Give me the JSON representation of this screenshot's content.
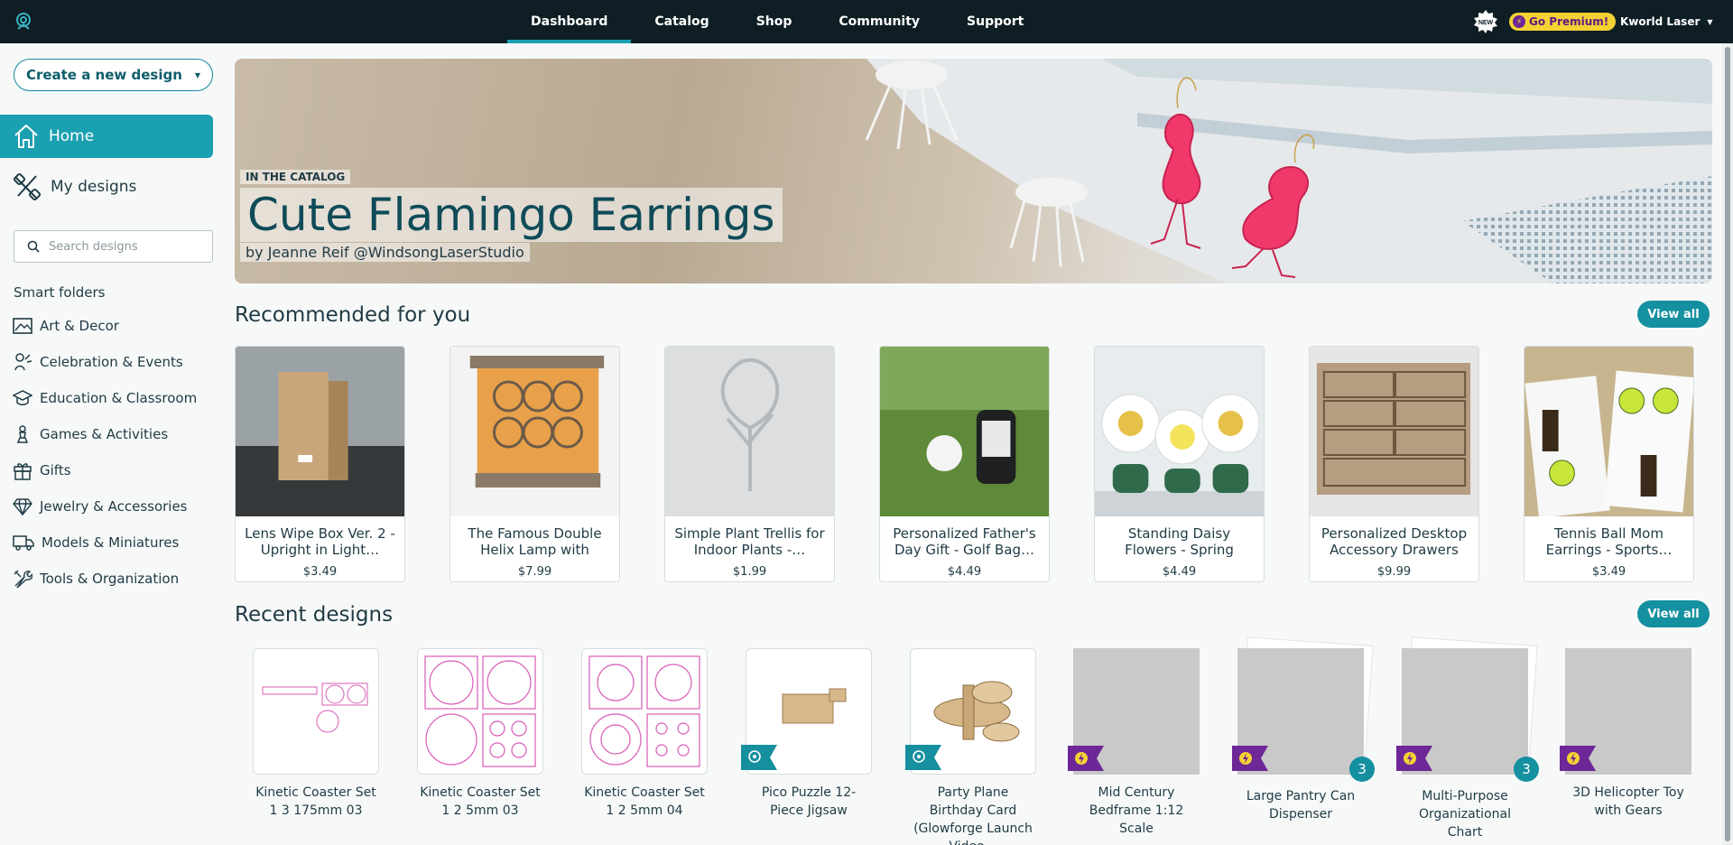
{
  "topbar": {
    "nav": [
      {
        "label": "Dashboard",
        "active": true
      },
      {
        "label": "Catalog",
        "active": false
      },
      {
        "label": "Shop",
        "active": false
      },
      {
        "label": "Community",
        "active": false
      },
      {
        "label": "Support",
        "active": false
      }
    ],
    "new_badge": "NEW",
    "premium_label": "Go Premium!",
    "user_name": "Kworld Laser"
  },
  "sidebar": {
    "create_label": "Create a new design",
    "home_label": "Home",
    "my_designs_label": "My designs",
    "search_placeholder": "Search designs",
    "smart_folders_title": "Smart folders",
    "folders": [
      {
        "label": "Art & Decor",
        "icon": "image-icon"
      },
      {
        "label": "Celebration & Events",
        "icon": "party-icon"
      },
      {
        "label": "Education & Classroom",
        "icon": "graduation-cap-icon"
      },
      {
        "label": "Games & Activities",
        "icon": "game-piece-icon"
      },
      {
        "label": "Gifts",
        "icon": "gift-icon"
      },
      {
        "label": "Jewelry & Accessories",
        "icon": "diamond-icon"
      },
      {
        "label": "Models & Miniatures",
        "icon": "truck-icon"
      },
      {
        "label": "Tools & Organization",
        "icon": "tools-icon"
      }
    ]
  },
  "hero": {
    "kicker": "IN THE CATALOG",
    "title": "Cute Flamingo Earrings",
    "byline": "by Jeanne Reif @WindsongLaserStudio"
  },
  "recommended": {
    "title": "Recommended for you",
    "view_all": "View all",
    "items": [
      {
        "name": "Lens Wipe Box Ver. 2 - Upright in Light…",
        "price": "$3.49"
      },
      {
        "name": "The Famous Double Helix Lamp with Feet,…",
        "price": "$7.99"
      },
      {
        "name": "Simple Plant Trellis for Indoor Plants -…",
        "price": "$1.99"
      },
      {
        "name": "Personalized Father's Day Gift - Golf Bag…",
        "price": "$4.49"
      },
      {
        "name": "Standing Daisy Flowers - Spring Flower Decor…",
        "price": "$4.49"
      },
      {
        "name": "Personalized Desktop Accessory Drawers",
        "price": "$9.99"
      },
      {
        "name": "Tennis Ball Mom Earrings - Sports…",
        "price": "$3.49"
      }
    ]
  },
  "recent": {
    "title": "Recent designs",
    "view_all": "View all",
    "items": [
      {
        "name": "Kinetic Coaster Set 1 3 175mm 03"
      },
      {
        "name": "Kinetic Coaster Set 1 2 5mm 03"
      },
      {
        "name": "Kinetic Coaster Set 1 2 5mm 04"
      },
      {
        "name": "Pico Puzzle 12-Piece Jigsaw",
        "ribbon": "glowforge-ribbon"
      },
      {
        "name": "Party Plane Birthday Card (Glowforge Launch Video…",
        "ribbon": "glowforge-ribbon"
      },
      {
        "name": "Mid Century Bedframe 1:12 Scale",
        "ribbon": "premium-ribbon"
      },
      {
        "name": "Large Pantry Can Dispenser",
        "ribbon": "premium-ribbon",
        "count": "3"
      },
      {
        "name": "Multi-Purpose Organizational Chart",
        "ribbon": "premium-ribbon",
        "count": "3"
      },
      {
        "name": "3D Helicopter Toy with Gears",
        "ribbon": "premium-ribbon"
      }
    ]
  },
  "colors": {
    "topbar": "#0e1e24",
    "accent": "#1aa0b0",
    "premium": "#f5d233",
    "premium_ribbon": "#6d2796"
  }
}
